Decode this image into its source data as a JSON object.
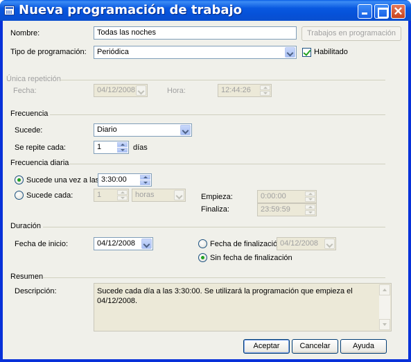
{
  "window": {
    "title": "Nueva programación de trabajo"
  },
  "general": {
    "name_label": "Nombre:",
    "name_value": "Todas las noches",
    "jobs_button": "Trabajos en programación",
    "type_label": "Tipo de programación:",
    "type_value": "Periódica",
    "enabled_label": "Habilitado",
    "enabled_checked": true
  },
  "single": {
    "section": "Única repetición",
    "date_label": "Fecha:",
    "date_value": "04/12/2008",
    "time_label": "Hora:",
    "time_value": "12:44:26"
  },
  "frequency": {
    "section": "Frecuencia",
    "occurs_label": "Sucede:",
    "occurs_value": "Diario",
    "repeat_label": "Se repite cada:",
    "repeat_value": "1",
    "repeat_unit": "días"
  },
  "daily": {
    "section": "Frecuencia diaria",
    "once_label": "Sucede una vez a las:",
    "once_value": "3:30:00",
    "every_label": "Sucede cada:",
    "every_value": "1",
    "every_unit": "horas",
    "start_label": "Empieza:",
    "start_value": "0:00:00",
    "end_label": "Finaliza:",
    "end_value": "23:59:59"
  },
  "duration": {
    "section": "Duración",
    "start_label": "Fecha de inicio:",
    "start_value": "04/12/2008",
    "end_label": "Fecha de finalización:",
    "end_value": "04/12/2008",
    "no_end_label": "Sin fecha de finalización"
  },
  "summary": {
    "section": "Resumen",
    "desc_label": "Descripción:",
    "desc_text": "Sucede cada día a las 3:30:00. Se utilizará la programación que empieza el 04/12/2008."
  },
  "buttons": {
    "ok": "Aceptar",
    "cancel": "Cancelar",
    "help": "Ayuda"
  },
  "colors": {
    "titlebar": "#0858e0",
    "dialog_bg": "#f0f0ea",
    "accent_check": "#21a121"
  }
}
